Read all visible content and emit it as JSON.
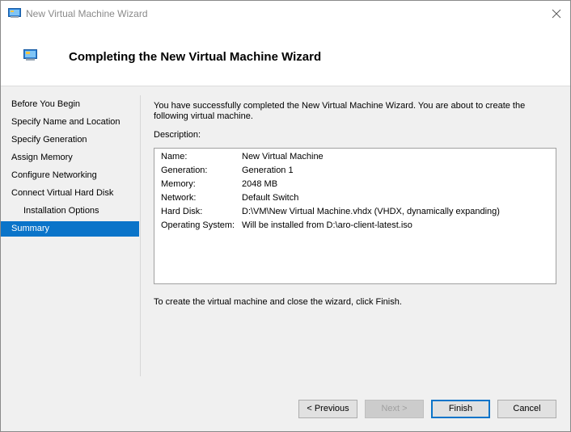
{
  "window": {
    "title": "New Virtual Machine Wizard",
    "icon": "virtual-machine-icon"
  },
  "header": {
    "title": "Completing the New Virtual Machine Wizard",
    "icon": "virtual-machine-icon"
  },
  "sidebar": {
    "items": [
      {
        "label": "Before You Begin",
        "active": false
      },
      {
        "label": "Specify Name and Location",
        "active": false
      },
      {
        "label": "Specify Generation",
        "active": false
      },
      {
        "label": "Assign Memory",
        "active": false
      },
      {
        "label": "Configure Networking",
        "active": false
      },
      {
        "label": "Connect Virtual Hard Disk",
        "active": false
      },
      {
        "label": "Installation Options",
        "active": false
      },
      {
        "label": "Summary",
        "active": true
      }
    ]
  },
  "main": {
    "intro": "You have successfully completed the New Virtual Machine Wizard. You are about to create the following virtual machine.",
    "description_label": "Description:",
    "description": [
      {
        "key": "Name:",
        "value": "New Virtual Machine"
      },
      {
        "key": "Generation:",
        "value": "Generation 1"
      },
      {
        "key": "Memory:",
        "value": "2048 MB"
      },
      {
        "key": "Network:",
        "value": "Default Switch"
      },
      {
        "key": "Hard Disk:",
        "value": "D:\\VM\\New Virtual Machine.vhdx (VHDX, dynamically expanding)"
      },
      {
        "key": "Operating System:",
        "value": "Will be installed from D:\\aro-client-latest.iso"
      }
    ],
    "footer": "To create the virtual machine and close the wizard, click Finish."
  },
  "buttons": {
    "previous": "< Previous",
    "next": "Next >",
    "finish": "Finish",
    "cancel": "Cancel"
  },
  "colors": {
    "accent": "#0a74c9",
    "title_text": "#8a8a8a"
  }
}
